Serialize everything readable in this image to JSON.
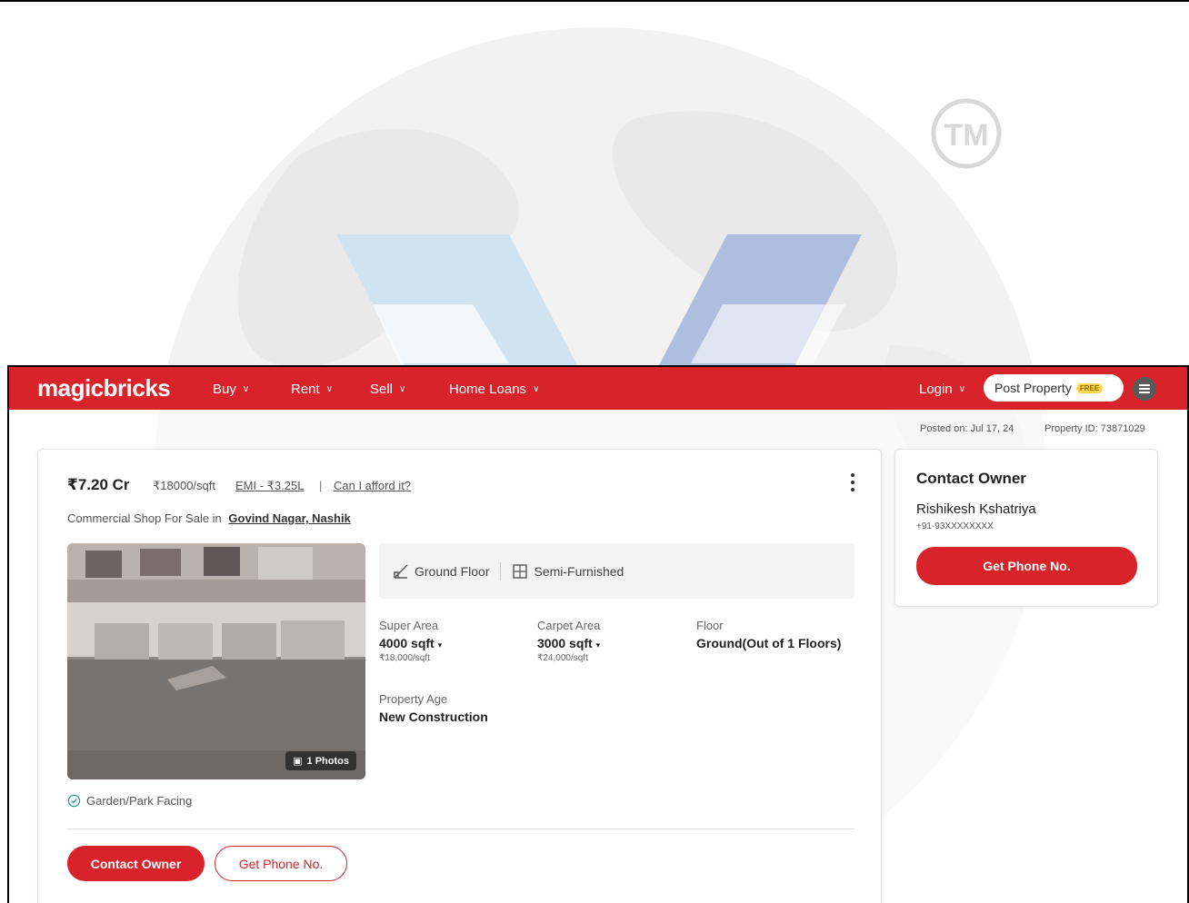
{
  "watermark": {
    "tm_text": "TM"
  },
  "navbar": {
    "logo": "magicbricks",
    "items": [
      {
        "label": "Buy"
      },
      {
        "label": "Rent"
      },
      {
        "label": "Sell"
      },
      {
        "label": "Home Loans"
      }
    ],
    "login_label": "Login",
    "post_property_label": "Post Property",
    "free_badge": "FREE",
    "brand_color": "#d8232a"
  },
  "meta": {
    "posted_on": "Posted on: Jul 17, 24",
    "property_id": "Property ID: 73871029"
  },
  "listing": {
    "price": "₹7.20 Cr",
    "rate": "₹18000/sqft",
    "emi": "EMI - ₹3.25L",
    "separator": "|",
    "afford_link": "Can I afford it?",
    "subtitle_prefix": "Commercial Shop For Sale in",
    "location": "Govind Nagar, Nashik",
    "photo_count": "1 Photos",
    "tags": {
      "floor": "Ground Floor",
      "furnishing": "Semi-Furnished"
    },
    "attributes": {
      "super_area": {
        "label": "Super Area",
        "value": "4000 sqft",
        "sub": "₹18,000/sqft"
      },
      "carpet_area": {
        "label": "Carpet Area",
        "value": "3000 sqft",
        "sub": "₹24,000/sqft"
      },
      "floor": {
        "label": "Floor",
        "value": "Ground(Out of 1 Floors)"
      },
      "property_age": {
        "label": "Property Age",
        "value": "New Construction"
      }
    },
    "feature": "Garden/Park Facing",
    "contact_owner_label": "Contact Owner",
    "get_phone_label": "Get Phone No."
  },
  "sidebar": {
    "title": "Contact Owner",
    "owner_name": "Rishikesh Kshatriya",
    "owner_phone": "+91-93XXXXXXXX",
    "get_phone_label": "Get Phone No."
  }
}
